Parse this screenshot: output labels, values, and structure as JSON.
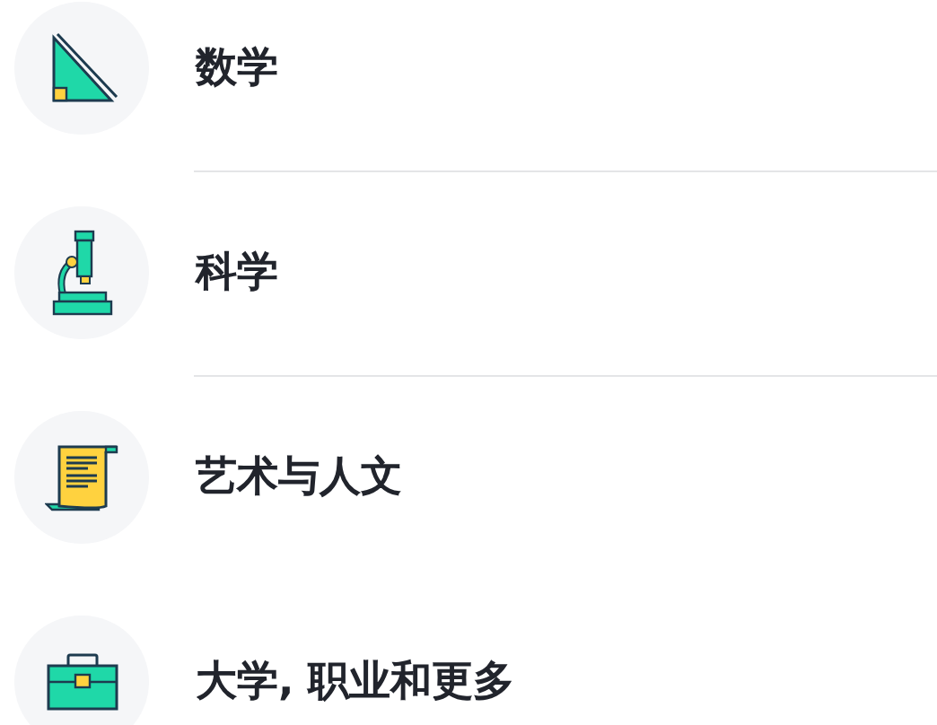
{
  "subjects": [
    {
      "kind": "math",
      "label": "数学",
      "divider": true
    },
    {
      "kind": "science",
      "label": "科学",
      "divider": true
    },
    {
      "kind": "arts",
      "label": "艺术与人文",
      "divider": false
    },
    {
      "kind": "college",
      "label": "大学, 职业和更多"
    }
  ]
}
